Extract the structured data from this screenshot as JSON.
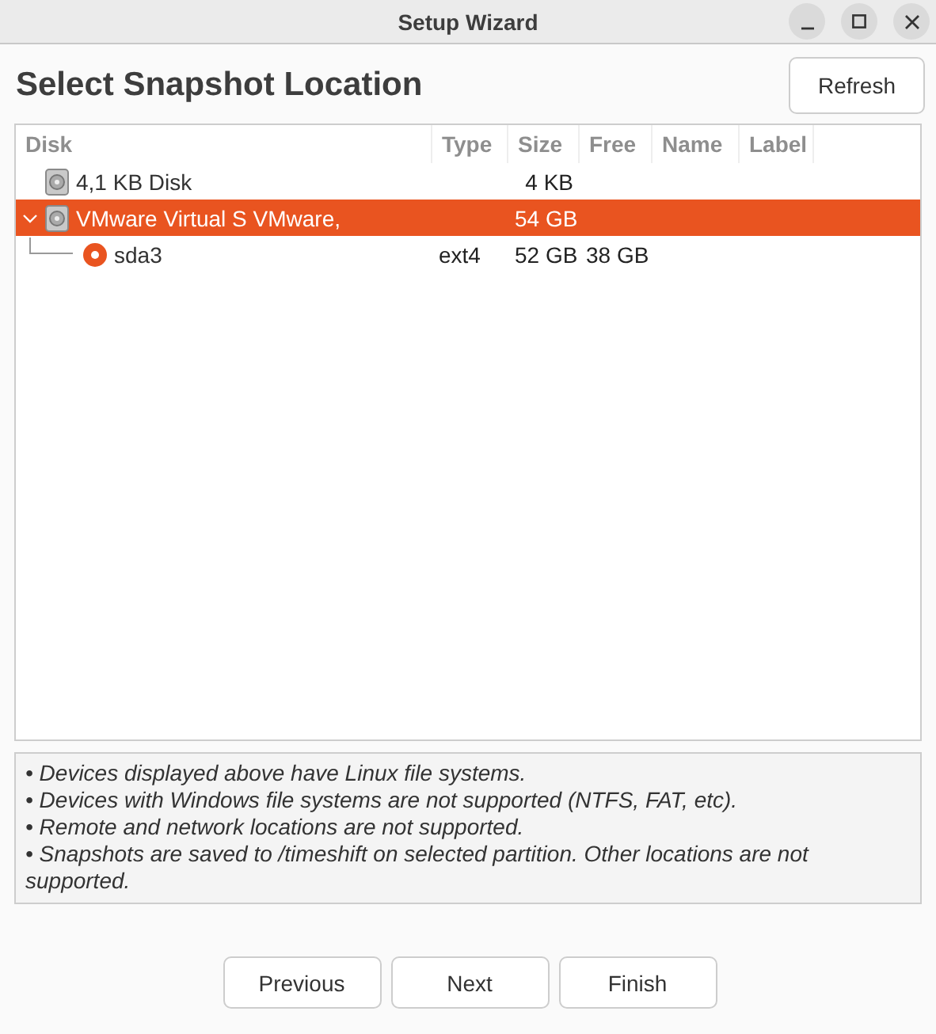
{
  "window": {
    "title": "Setup Wizard"
  },
  "heading": "Select Snapshot Location",
  "refresh_button": "Refresh",
  "table": {
    "columns": [
      "Disk",
      "Type",
      "Size",
      "Free",
      "Name",
      "Label"
    ],
    "rows": [
      {
        "kind": "disk",
        "disk": "4,1 KB Disk",
        "size": "4 KB",
        "selected": false,
        "expanded": false
      },
      {
        "kind": "disk",
        "disk": "VMware Virtual S VMware,",
        "size": "54 GB",
        "selected": true,
        "expanded": true,
        "children": [
          {
            "kind": "partition",
            "disk": "sda3",
            "type": "ext4",
            "size": "52 GB",
            "free": "38 GB",
            "selected": false
          }
        ]
      }
    ]
  },
  "notes": [
    "• Devices displayed above have Linux file systems.",
    "• Devices with Windows file systems are not supported (NTFS, FAT, etc).",
    "• Remote and network locations are not supported.",
    "• Snapshots are saved to /timeshift on selected partition. Other locations are not supported."
  ],
  "buttons": [
    "Previous",
    "Next",
    "Finish"
  ]
}
